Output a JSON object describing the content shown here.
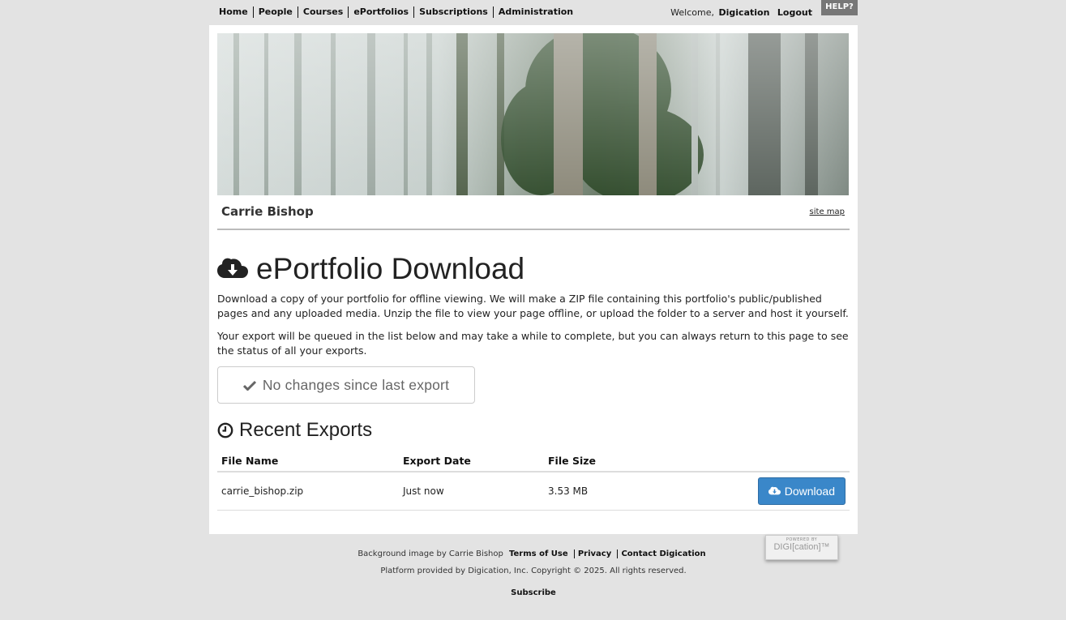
{
  "topnav": {
    "items": [
      "Home",
      "People",
      "Courses",
      "ePortfolios",
      "Subscriptions",
      "Administration"
    ],
    "welcome_prefix": "Welcome,",
    "username": "Digication",
    "logout": "Logout",
    "help": "HELP?"
  },
  "portfolio": {
    "owner": "Carrie Bishop",
    "sitemap": "site map"
  },
  "main": {
    "title": "ePortfolio Download",
    "paragraph1": "Download a copy of your portfolio for offline viewing. We will make a ZIP file containing this portfolio's public/published pages and any uploaded media. Unzip the file to view your page offline, or upload the folder to a server and host it yourself.",
    "paragraph2": "Your export will be queued in the list below and may take a while to complete, but you can always return to this page to see the status of all your exports.",
    "status_button": "No changes since last export",
    "recent_title": "Recent Exports"
  },
  "table": {
    "headers": [
      "File Name",
      "Export Date",
      "File Size"
    ],
    "rows": [
      {
        "file": "carrie_bishop.zip",
        "date": "Just now",
        "size": "3.53 MB",
        "action": "Download"
      }
    ]
  },
  "footer": {
    "bg_credit": "Background image by Carrie Bishop",
    "links": [
      "Terms of Use",
      "Privacy",
      "Contact Digication"
    ],
    "copyright": "Platform provided by Digication, Inc. Copyright © 2025. All rights reserved.",
    "subscribe": "Subscribe",
    "badge_top": "POWERED BY",
    "badge_name": "DIGI[cation]™"
  },
  "colors": {
    "primary_button": "#3a87c9",
    "page_bg": "#e3e3e3"
  },
  "icons": {
    "title": "cloud-download-icon",
    "status": "check-icon",
    "recent": "clock-icon",
    "download": "cloud-download-icon"
  }
}
